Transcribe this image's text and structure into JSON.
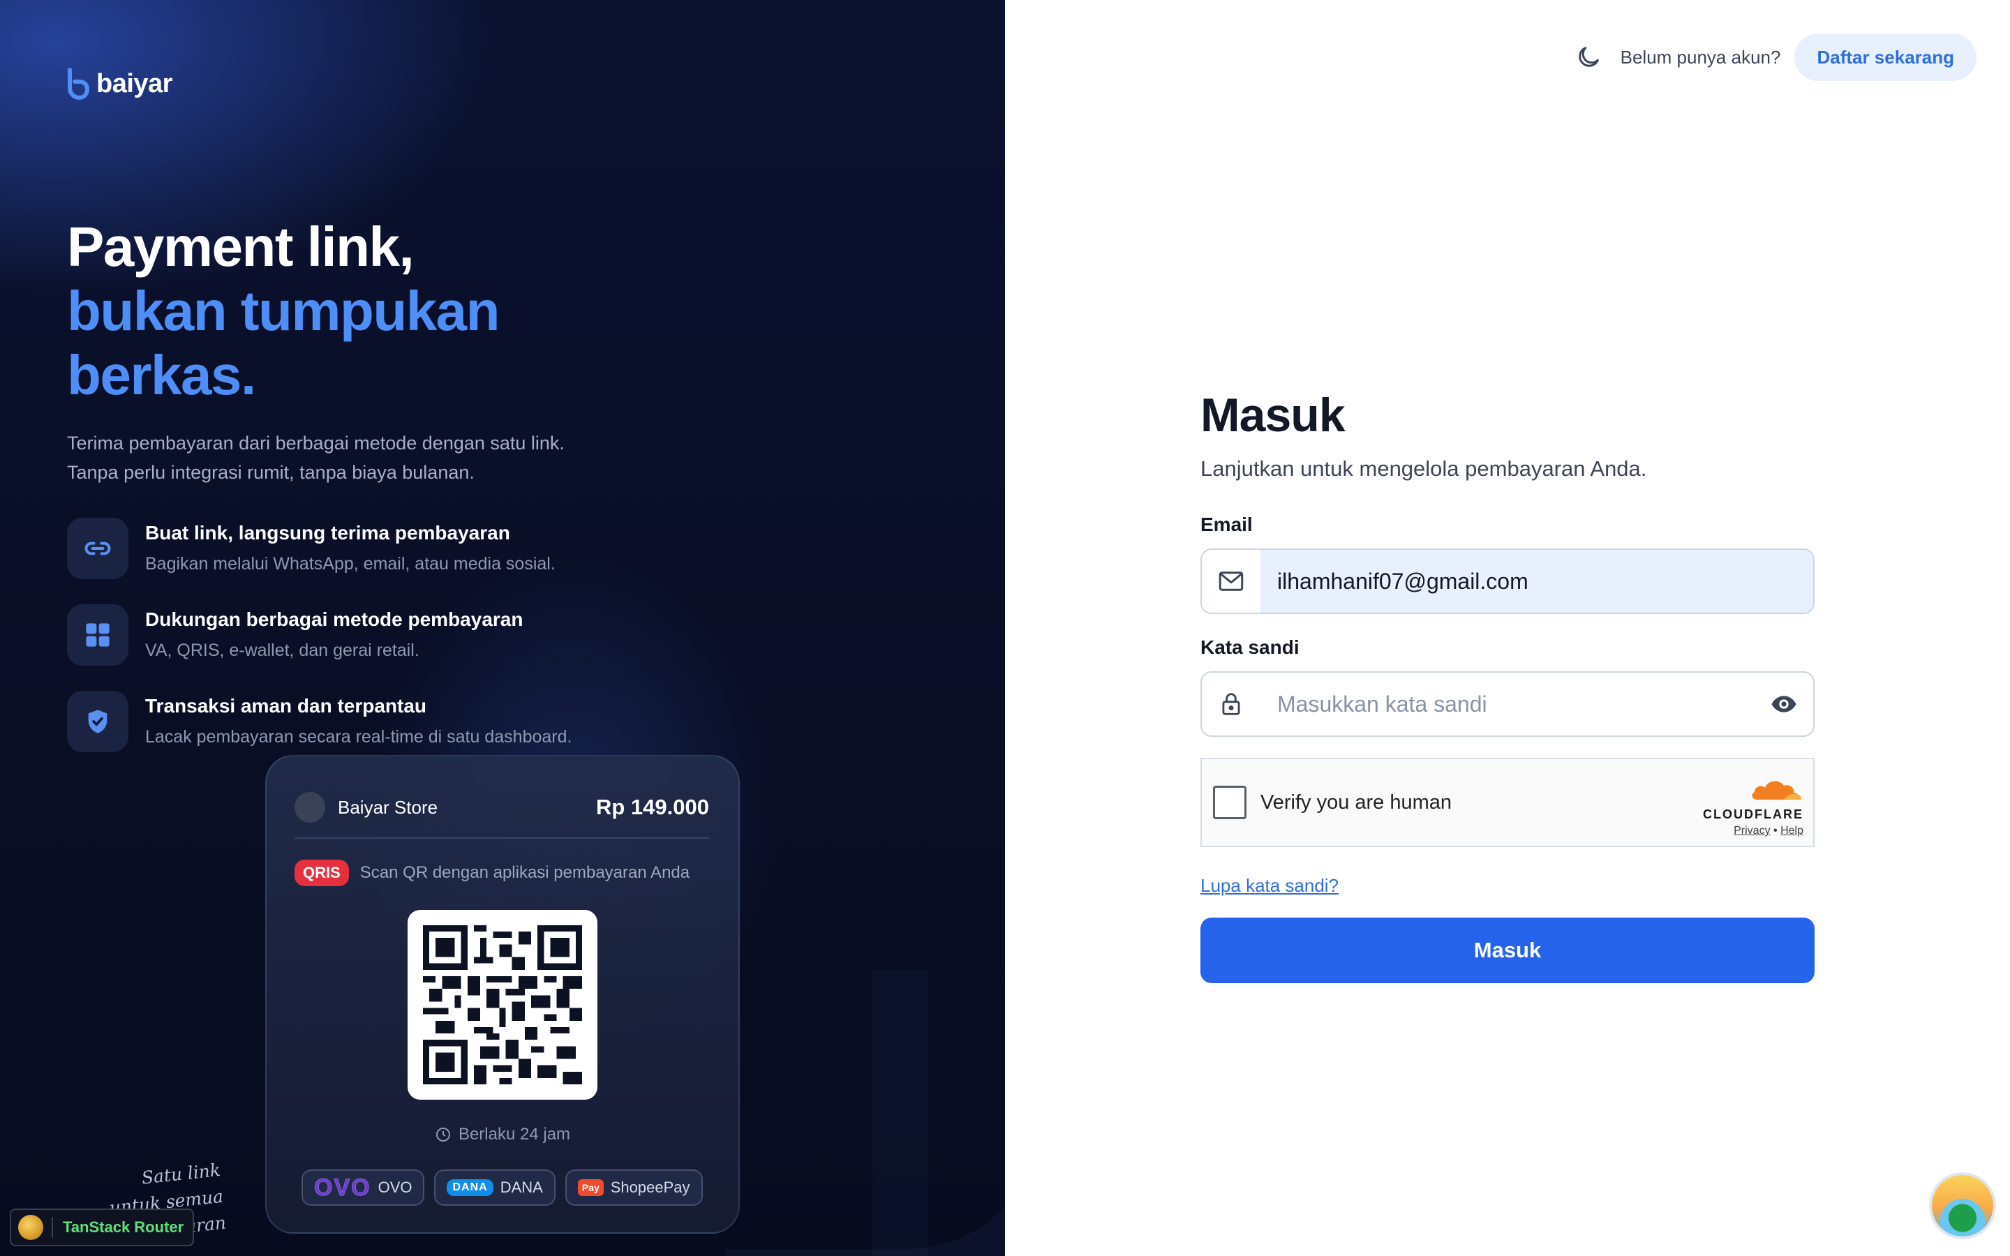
{
  "brand": {
    "name": "baiyar"
  },
  "hero": {
    "line1": "Payment link,",
    "line2": "bukan tumpukan",
    "line3": "berkas.",
    "tagline1": "Terima pembayaran dari berbagai metode dengan satu link.",
    "tagline2": "Tanpa perlu integrasi rumit, tanpa biaya bulanan."
  },
  "features": [
    {
      "icon": "link-icon",
      "title": "Buat link, langsung terima pembayaran",
      "desc": "Bagikan melalui WhatsApp, email, atau media sosial."
    },
    {
      "icon": "grid-icon",
      "title": "Dukungan berbagai metode pembayaran",
      "desc": "VA, QRIS, e-wallet, dan gerai retail."
    },
    {
      "icon": "shield-check-icon",
      "title": "Transaksi aman dan terpantau",
      "desc": "Lacak pembayaran secara real-time di satu dashboard."
    }
  ],
  "payment_card": {
    "store": "Baiyar Store",
    "price": "Rp 149.000",
    "badge": "QRIS",
    "instruction": "Scan QR dengan aplikasi pembayaran Anda",
    "validity": "Berlaku 24 jam",
    "wallets": [
      {
        "logo": "OVO",
        "label": "OVO"
      },
      {
        "logo": "DANA",
        "label": "DANA"
      },
      {
        "logo": "Pay",
        "label": "ShopeePay"
      }
    ]
  },
  "handwritten": {
    "line1": "Satu link",
    "line2": "untuk semua",
    "line3": "aran"
  },
  "devtools": {
    "label": "TanStack Router"
  },
  "topbar": {
    "prompt": "Belum punya akun?",
    "signup_label": "Daftar sekarang",
    "theme_icon": "moon-icon"
  },
  "login": {
    "title": "Masuk",
    "subtitle": "Lanjutkan untuk mengelola pembayaran Anda.",
    "email_label": "Email",
    "email_value": "ilhamhanif07@gmail.com",
    "password_label": "Kata sandi",
    "password_placeholder": "Masukkan kata sandi",
    "captcha_text": "Verify you are human",
    "captcha_brand": "CLOUDFLARE",
    "captcha_privacy": "Privacy",
    "captcha_dot": "•",
    "captcha_help": "Help",
    "forgot_label": "Lupa kata sandi?",
    "submit_label": "Masuk"
  },
  "colors": {
    "accent": "#2563eb",
    "headline_blue": "#4f8ef7",
    "left_bg": "#0a0f27",
    "qris_red": "#e5303e"
  }
}
